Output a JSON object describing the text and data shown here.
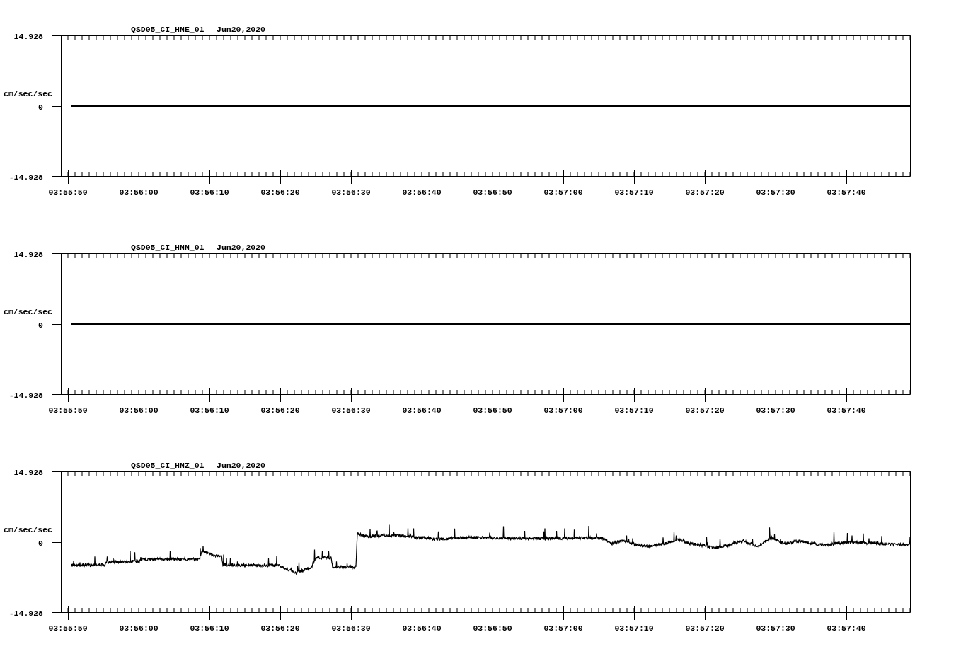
{
  "panels": [
    {
      "station": "QSD05_CI_HNE_01",
      "date": "Jun20,2020",
      "y_label": "cm/sec/sec",
      "y_ticks": [
        "14.928",
        "0",
        "-14.928"
      ],
      "x_ticks": [
        "03:55:50",
        "03:56:00",
        "03:56:10",
        "03:56:20",
        "03:56:30",
        "03:56:40",
        "03:56:50",
        "03:57:00",
        "03:57:10",
        "03:57:20",
        "03:57:30",
        "03:57:40"
      ],
      "trace": {
        "kind": "flat"
      }
    },
    {
      "station": "QSD05_CI_HNN_01",
      "date": "Jun20,2020",
      "y_label": "cm/sec/sec",
      "y_ticks": [
        "14.928",
        "0",
        "-14.928"
      ],
      "x_ticks": [
        "03:55:50",
        "03:56:00",
        "03:56:10",
        "03:56:20",
        "03:56:30",
        "03:56:40",
        "03:56:50",
        "03:57:00",
        "03:57:10",
        "03:57:20",
        "03:57:30",
        "03:57:40"
      ],
      "trace": {
        "kind": "flat"
      }
    },
    {
      "station": "QSD05_CI_HNZ_01",
      "date": "Jun20,2020",
      "y_label": "cm/sec/sec",
      "y_ticks": [
        "14.928",
        "0",
        "-14.928"
      ],
      "x_ticks": [
        "03:55:50",
        "03:56:00",
        "03:56:10",
        "03:56:20",
        "03:56:30",
        "03:56:40",
        "03:56:50",
        "03:57:00",
        "03:57:10",
        "03:57:20",
        "03:57:30",
        "03:57:40"
      ],
      "trace": {
        "kind": "noisy"
      }
    }
  ]
}
